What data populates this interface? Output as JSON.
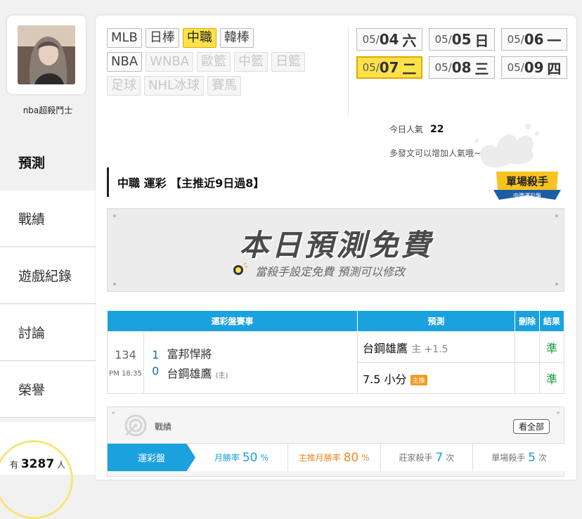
{
  "sidebar": {
    "username": "nba超殺鬥士",
    "nav": [
      "預測",
      "戰績",
      "遊戲紀錄",
      "討論",
      "榮譽"
    ],
    "popularity_prefix": "有",
    "popularity_count": "3287",
    "popularity_suffix": "人"
  },
  "leagues": {
    "row1": [
      "MLB",
      "日棒",
      "中職",
      "韓棒"
    ],
    "row2": [
      "NBA",
      "WNBA",
      "歐籃",
      "中籃",
      "日籃"
    ],
    "row3": [
      "足球",
      "NHL冰球",
      "賽馬"
    ],
    "selected": "中職"
  },
  "dates": [
    {
      "prefix": "05/",
      "day": "04",
      "wd": "六",
      "selected": false
    },
    {
      "prefix": "05/",
      "day": "05",
      "wd": "日",
      "selected": false
    },
    {
      "prefix": "05/",
      "day": "06",
      "wd": "一",
      "selected": false
    },
    {
      "prefix": "05/",
      "day": "07",
      "wd": "二",
      "selected": true
    },
    {
      "prefix": "05/",
      "day": "08",
      "wd": "三",
      "selected": false
    },
    {
      "prefix": "05/",
      "day": "09",
      "wd": "四",
      "selected": false
    }
  ],
  "popularity": {
    "label": "今日人氣",
    "value": "22",
    "hint": "多發文可以增加人氣哦~"
  },
  "section_title": "中職 運彩 【主推近9日過8】",
  "badge": {
    "main": "單場殺手",
    "sub": "中職運彩盤"
  },
  "free_banner": {
    "title": "本日預測免費",
    "subtitle": "當殺手設定免費 預測可以修改"
  },
  "table": {
    "headers": {
      "event": "運彩盤賽事",
      "prediction": "預測",
      "delete": "刪除",
      "result": "結果"
    },
    "game": {
      "id": "134",
      "time": "PM 18:35",
      "away_score": "1",
      "away_team": "富邦悍將",
      "home_score": "0",
      "home_team": "台鋼雄鷹",
      "home_tag": "(主)"
    },
    "predictions": [
      {
        "pick": "台鋼雄鷹",
        "extra": "主 +1.5",
        "tag": "",
        "result": "準"
      },
      {
        "pick": "7.5 小分",
        "extra": "",
        "tag": "主推",
        "result": "準"
      }
    ]
  },
  "record": {
    "title": "戰績",
    "see_all": "看全部",
    "tab": "運彩盤",
    "monthly_label": "月勝率",
    "monthly_value": "50",
    "main_label": "主推月勝率",
    "main_value": "80",
    "pct": "%",
    "banker_label": "莊家殺手",
    "banker_value": "7",
    "single_label": "單場殺手",
    "single_value": "5",
    "times": "次"
  },
  "colors": {
    "accent": "#1aa1de",
    "selected": "#ffe24a",
    "win": "#1a9a3a"
  }
}
